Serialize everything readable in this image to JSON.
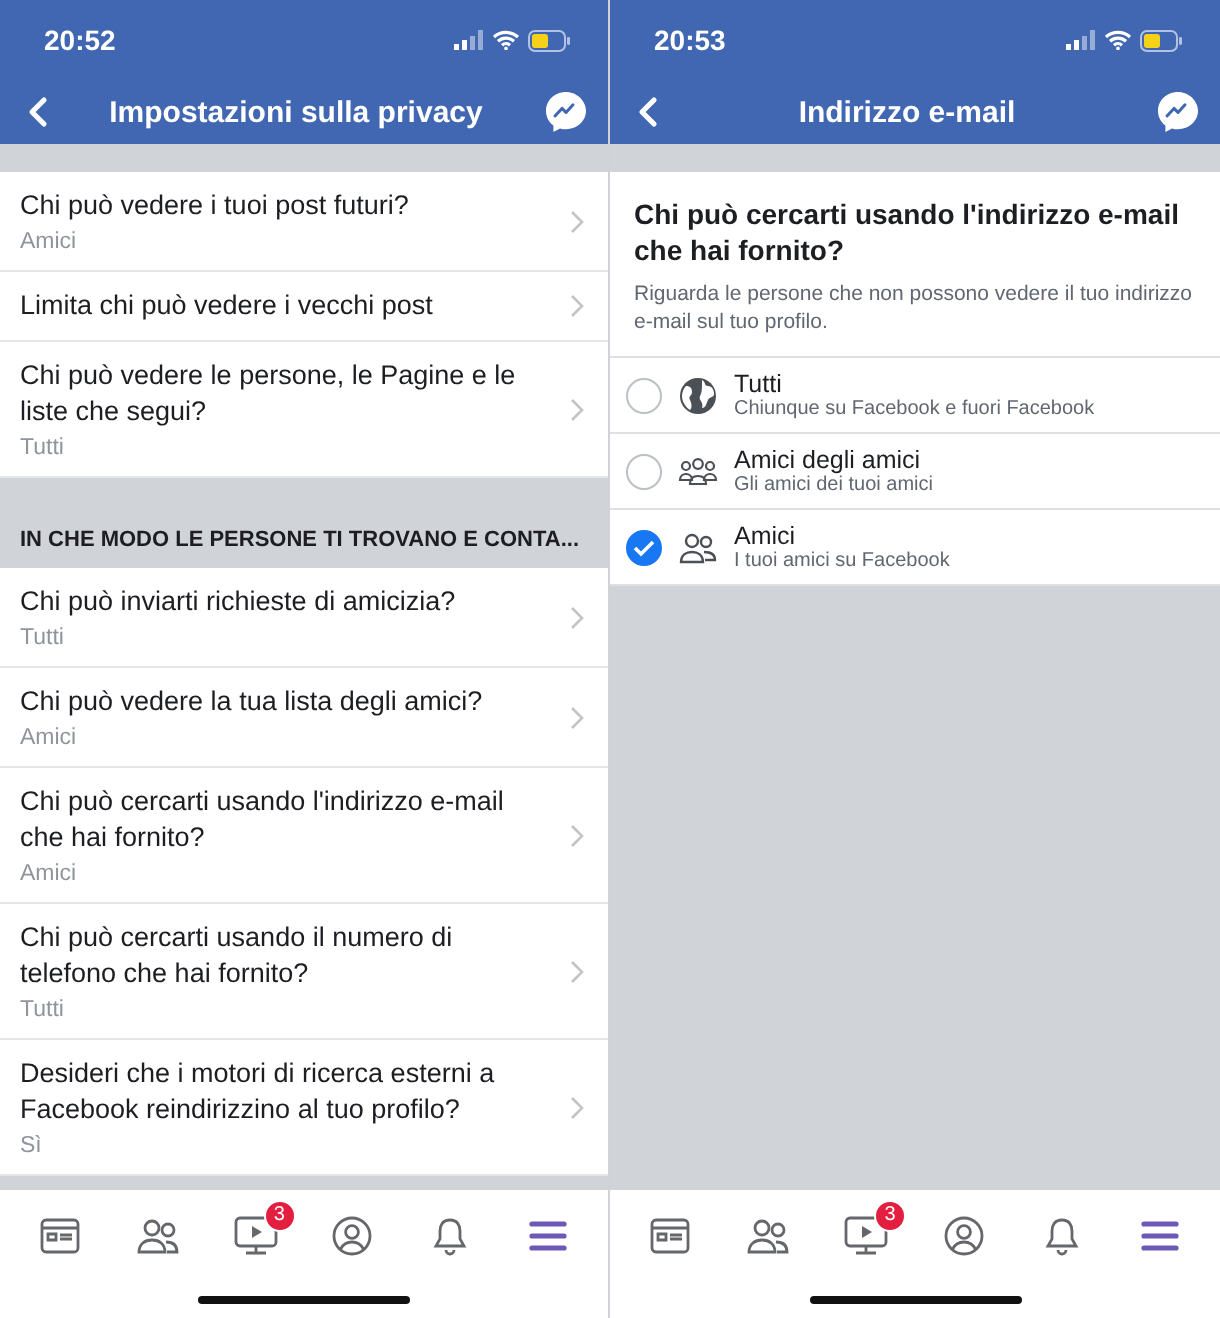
{
  "privacy_screen": {
    "status_bar": {
      "time": "20:52"
    },
    "nav": {
      "title": "Impostazioni sulla privacy"
    },
    "sections": [
      {
        "rows": [
          {
            "title": "Chi può vedere i tuoi post futuri?",
            "value": "Amici"
          },
          {
            "title": "Limita chi può vedere i vecchi post"
          },
          {
            "title": "Chi può vedere le persone, le Pagine e le liste che segui?",
            "value": "Tutti"
          }
        ]
      },
      {
        "header": "IN CHE MODO LE PERSONE TI TROVANO E CONTA...",
        "rows": [
          {
            "title": "Chi può inviarti richieste di amicizia?",
            "value": "Tutti"
          },
          {
            "title": "Chi può vedere la tua lista degli amici?",
            "value": "Amici"
          },
          {
            "title": "Chi può cercarti usando l'indirizzo e-mail che hai fornito?",
            "value": "Amici"
          },
          {
            "title": "Chi può cercarti usando il numero di telefono che hai fornito?",
            "value": "Tutti"
          },
          {
            "title": "Desideri che i motori di ricerca esterni a Facebook reindirizzino al tuo profilo?",
            "value": "Sì"
          }
        ]
      }
    ],
    "tabs": [
      {
        "selected": false
      },
      {
        "selected": false
      },
      {
        "selected": false,
        "badge": "3"
      },
      {
        "selected": false
      },
      {
        "selected": false
      },
      {
        "selected": true
      }
    ]
  },
  "email_screen": {
    "status_bar": {
      "time": "20:53"
    },
    "nav": {
      "title": "Indirizzo e-mail"
    },
    "question": "Chi può cercarti usando l'indirizzo e-mail che hai fornito?",
    "description": "Riguarda le persone che non possono vedere il tuo indirizzo e-mail sul tuo profilo.",
    "options": [
      {
        "kind": "globe",
        "label": "Tutti",
        "description": "Chiunque su Facebook e fuori Facebook",
        "selected": false
      },
      {
        "kind": "friends_of_friends",
        "label": "Amici degli amici",
        "description": "Gli amici dei tuoi amici",
        "selected": false
      },
      {
        "kind": "friends",
        "label": "Amici",
        "description": "I tuoi amici su Facebook",
        "selected": true
      }
    ],
    "tabs": [
      {
        "selected": false
      },
      {
        "selected": false
      },
      {
        "selected": false,
        "badge": "3"
      },
      {
        "selected": false
      },
      {
        "selected": false
      },
      {
        "selected": true
      }
    ]
  }
}
